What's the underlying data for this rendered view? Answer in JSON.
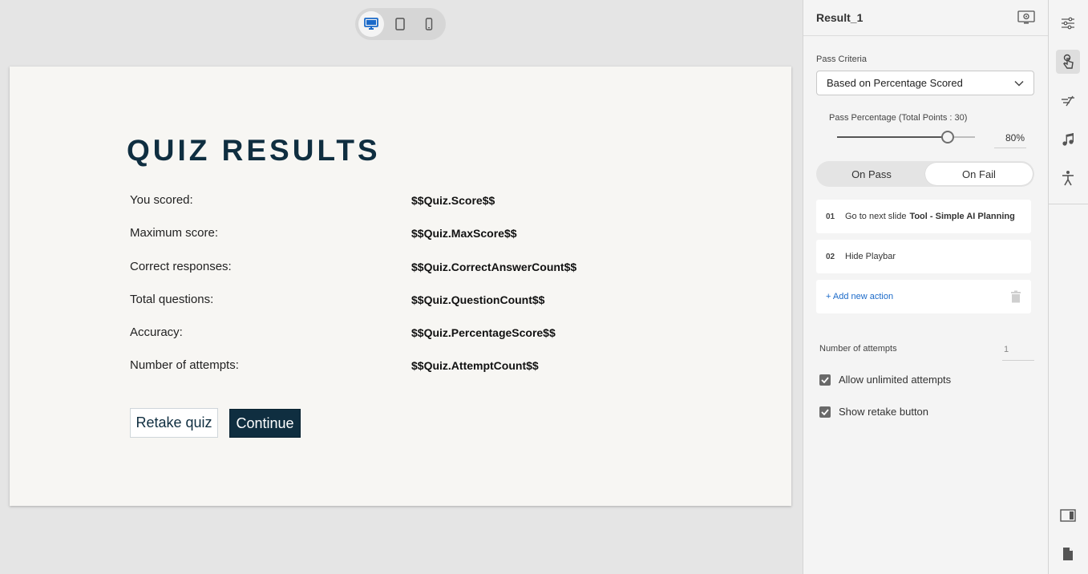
{
  "device_bar": {
    "items": [
      {
        "icon": "desktop-icon",
        "active": true
      },
      {
        "icon": "tablet-icon",
        "active": false
      },
      {
        "icon": "mobile-icon",
        "active": false
      }
    ]
  },
  "slide": {
    "title": "QUIZ RESULTS",
    "rows": [
      {
        "label": "You scored:",
        "value": "$$Quiz.Score$$"
      },
      {
        "label": "Maximum score:",
        "value": "$$Quiz.MaxScore$$"
      },
      {
        "label": "Correct responses:",
        "value": "$$Quiz.CorrectAnswerCount$$"
      },
      {
        "label": "Total questions:",
        "value": "$$Quiz.QuestionCount$$"
      },
      {
        "label": "Accuracy:",
        "value": "$$Quiz.PercentageScore$$"
      },
      {
        "label": "Number of attempts:",
        "value": "$$Quiz.AttemptCount$$"
      }
    ],
    "retake_label": "Retake quiz",
    "continue_label": "Continue",
    "title_color": "#0f2e40"
  },
  "panel": {
    "title": "Result_1",
    "header_icon": "preview-icon",
    "pass_criteria_label": "Pass Criteria",
    "pass_criteria_value": "Based on Percentage Scored",
    "pass_percentage_label": "Pass Percentage (Total Points : 30)",
    "pass_percentage_value": "80%",
    "pass_percentage_level": 0.8,
    "tabs": [
      {
        "label": "On Pass",
        "active": false
      },
      {
        "label": "On Fail",
        "active": true
      }
    ],
    "actions": [
      {
        "num": "01",
        "text": "Go to next slide",
        "target": "Tool - Simple AI Planning"
      },
      {
        "num": "02",
        "text": "Hide Playbar",
        "target": ""
      }
    ],
    "add_action_label": "+ Add new action",
    "attempts_label": "Number of attempts",
    "attempts_value": "1",
    "allow_unlimited_label": "Allow unlimited attempts",
    "allow_unlimited_checked": true,
    "show_retake_label": "Show retake button",
    "show_retake_checked": true,
    "accent_color": "#1b6ac9"
  },
  "rail": {
    "items": [
      {
        "icon": "properties-sliders-icon",
        "active": false
      },
      {
        "icon": "interaction-touch-icon",
        "active": true
      },
      {
        "icon": "animation-icon",
        "active": false
      },
      {
        "icon": "audio-note-icon",
        "active": false
      },
      {
        "icon": "accessibility-icon",
        "active": false
      },
      {
        "icon": "slide-layout-icon",
        "active": false
      },
      {
        "icon": "document-icon",
        "active": false
      }
    ]
  }
}
